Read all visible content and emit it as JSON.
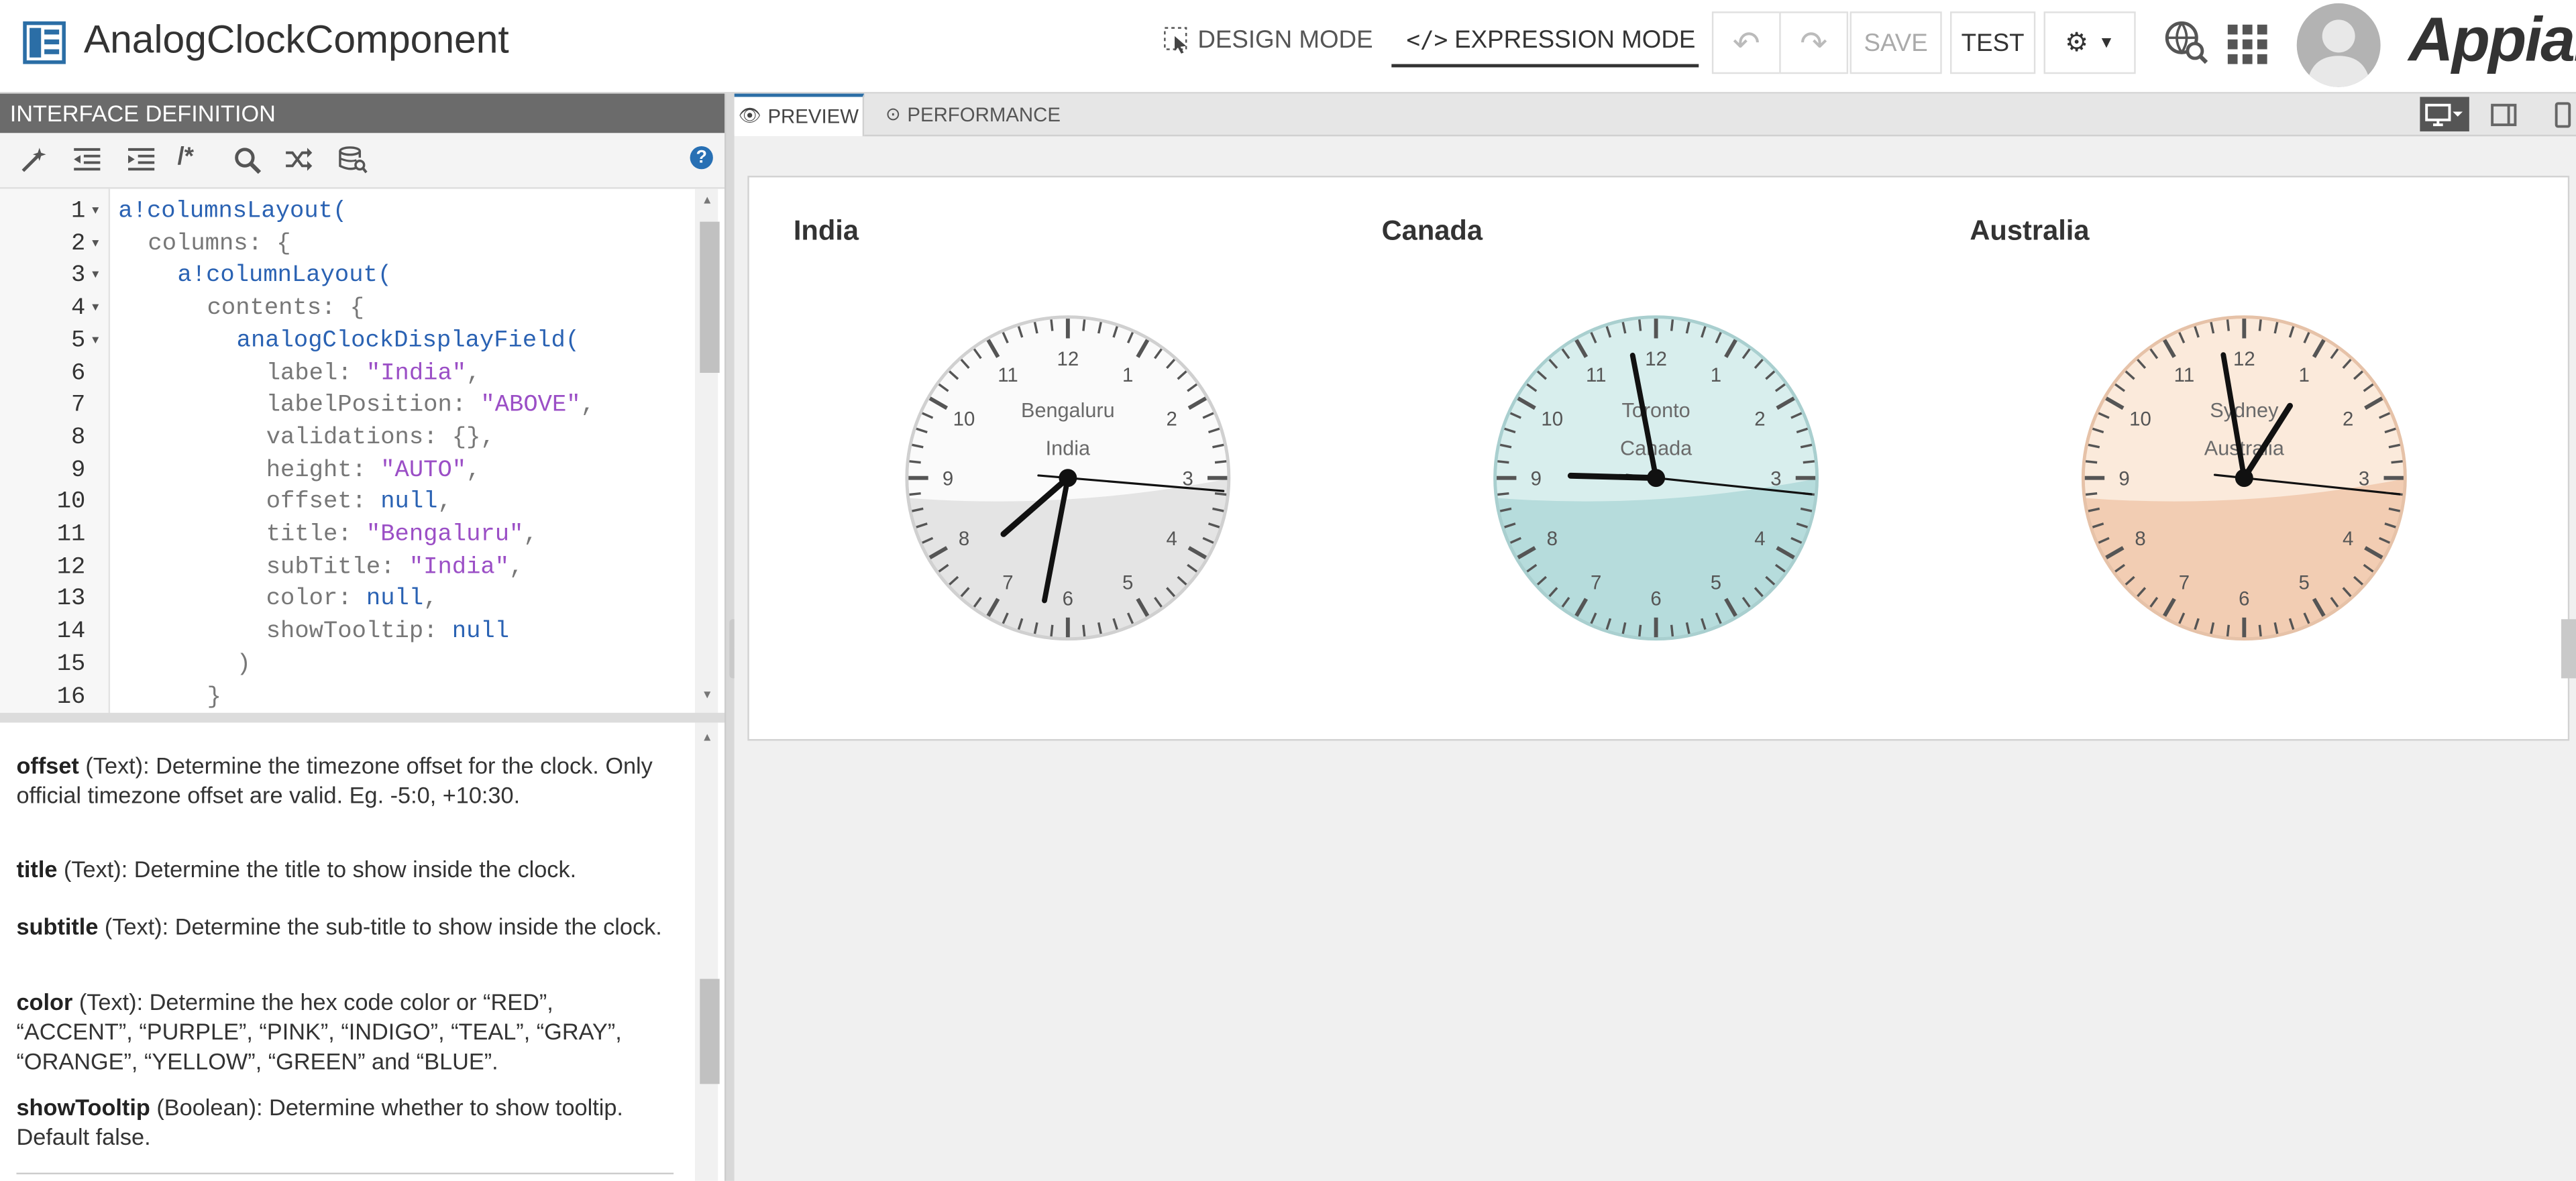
{
  "header": {
    "app_title": "AnalogClockComponent",
    "design_mode_label": "DESIGN MODE",
    "expression_mode_label": "EXPRESSION MODE",
    "save_label": "SAVE",
    "test_label": "TEST",
    "brand": "Appian"
  },
  "left_pane": {
    "header": "INTERFACE DEFINITION",
    "toolbar_icons": [
      "magic-wand-icon",
      "outdent-icon",
      "indent-icon",
      "comment-icon",
      "search-icon",
      "shuffle-icon",
      "db-search-icon"
    ],
    "help": "?"
  },
  "code": {
    "lines": [
      {
        "n": "1",
        "fold": true
      },
      {
        "n": "2",
        "fold": true
      },
      {
        "n": "3",
        "fold": true
      },
      {
        "n": "4",
        "fold": true
      },
      {
        "n": "5",
        "fold": true
      },
      {
        "n": "6"
      },
      {
        "n": "7"
      },
      {
        "n": "8"
      },
      {
        "n": "9"
      },
      {
        "n": "10"
      },
      {
        "n": "11"
      },
      {
        "n": "12"
      },
      {
        "n": "13"
      },
      {
        "n": "14"
      },
      {
        "n": "15"
      },
      {
        "n": "16"
      }
    ],
    "l1": "a!columnsLayout(",
    "l2": "columns: {",
    "l3": "a!columnLayout(",
    "l4": "contents: {",
    "l5": "analogClockDisplayField(",
    "l6_key": "label: ",
    "l6_val": "\"India\"",
    "l7_key": "labelPosition: ",
    "l7_val": "\"ABOVE\"",
    "l8": "validations: {},",
    "l9_key": "height: ",
    "l9_val": "\"AUTO\"",
    "l10_key": "offset: ",
    "l10_val": "null",
    "l11_key": "title: ",
    "l11_val": "\"Bengaluru\"",
    "l12_key": "subTitle: ",
    "l12_val": "\"India\"",
    "l13_key": "color: ",
    "l13_val": "null",
    "l14_key": "showTooltip: ",
    "l14_val": "null",
    "l15": ")",
    "l16": "}"
  },
  "docs": [
    {
      "term": "offset",
      "rest": " (Text): Determine the timezone offset for the clock. Only official timezone offset are valid. Eg. -5:0, +10:30."
    },
    {
      "term": "title",
      "rest": " (Text): Determine the title to show inside the clock."
    },
    {
      "term": "subtitle",
      "rest": " (Text): Determine the sub-title to show inside the clock."
    },
    {
      "term": "color",
      "rest": " (Text): Determine the hex code color or “RED”, “ACCENT”, “PURPLE”, “PINK”, “INDIGO”, “TEAL”, “GRAY”, “ORANGE”, “YELLOW”, “GREEN” and “BLUE”."
    },
    {
      "term": "showTooltip",
      "rest": " (Boolean): Determine whether to show tooltip. Default false."
    }
  ],
  "right_pane": {
    "tab_preview": "PREVIEW",
    "tab_performance": "PERFORMANCE"
  },
  "clocks": [
    {
      "label": "India",
      "title": "Bengaluru",
      "subtitle": "India",
      "theme": "gray",
      "hour": 7.63,
      "minute": 31.8,
      "second": 15.8,
      "top": "#fafafa",
      "bottom": "#e4e4e4",
      "rim": "#d0d0d0"
    },
    {
      "label": "Canada",
      "title": "Toronto",
      "subtitle": "Canada",
      "theme": "teal",
      "hour": 9.05,
      "minute": 58.2,
      "second": 16.0,
      "top": "#d8eeed",
      "bottom": "#b6dcdc",
      "rim": "#a9cfcf"
    },
    {
      "label": "Australia",
      "title": "Sydney",
      "subtitle": "Australia",
      "theme": "orange",
      "hour": 1.08,
      "minute": 58.4,
      "second": 16.0,
      "top": "#fbeadb",
      "bottom": "#f2cdb3",
      "rim": "#e6c2a8"
    }
  ]
}
